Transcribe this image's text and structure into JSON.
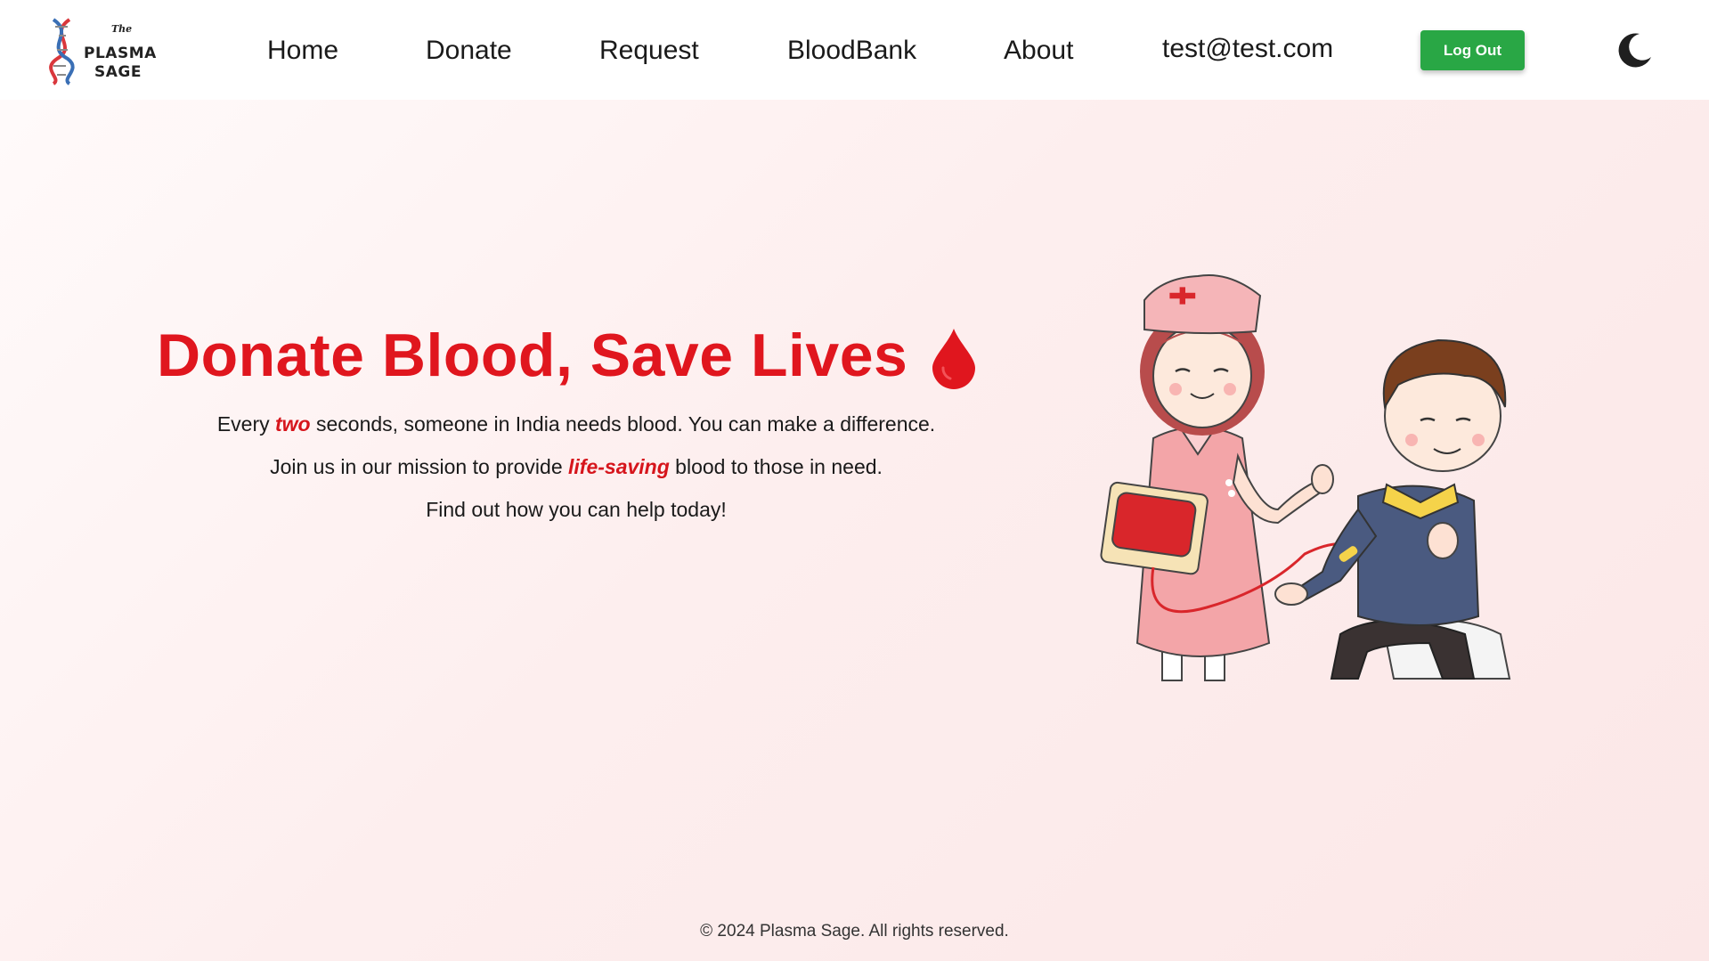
{
  "logo": {
    "the": "The",
    "line1": "PLASMA",
    "line2": "SAGE"
  },
  "nav": {
    "home": "Home",
    "donate": "Donate",
    "request": "Request",
    "bloodbank": "BloodBank",
    "about": "About",
    "user_email": "test@test.com",
    "logout_label": "Log Out",
    "theme_icon": "moon-icon"
  },
  "hero": {
    "title": "Donate Blood, Save Lives",
    "title_icon": "blood-drop-icon",
    "line1_a": "Every ",
    "line1_em": "two",
    "line1_b": " seconds, someone in India needs blood. You can make a difference.",
    "line2_a": "Join us in our mission to provide ",
    "line2_em": "life-saving",
    "line2_b": " blood to those in need.",
    "line3": "Find out how you can help today!"
  },
  "illustration": {
    "subject": "nurse-with-blood-bag-and-boy-donor"
  },
  "footer": {
    "copyright": "© 2024 Plasma Sage. All rights reserved."
  },
  "colors": {
    "accent_red": "#e0161e",
    "logout_green": "#29a745",
    "background_tint": "#fdeeee"
  }
}
